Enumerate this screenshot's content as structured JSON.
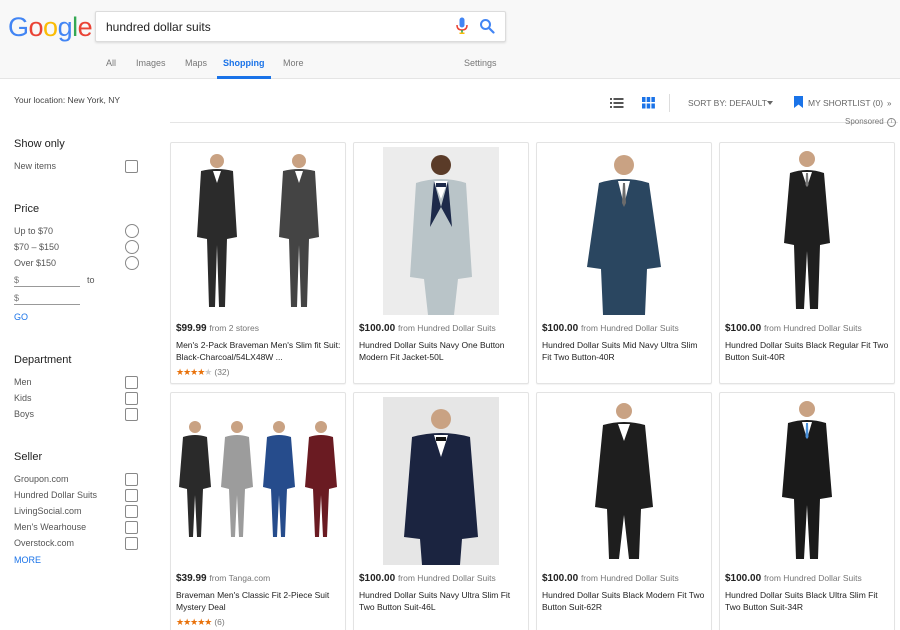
{
  "logo": {
    "letters": [
      "G",
      "o",
      "o",
      "g",
      "l",
      "e"
    ],
    "colors": [
      "#4285f4",
      "#ea4335",
      "#fbbc05",
      "#4285f4",
      "#34a853",
      "#ea4335"
    ]
  },
  "search": {
    "query": "hundred dollar suits"
  },
  "tabs": [
    {
      "label": "All"
    },
    {
      "label": "Images"
    },
    {
      "label": "Maps"
    },
    {
      "label": "Shopping"
    },
    {
      "label": "More"
    },
    {
      "label": "Settings"
    }
  ],
  "sidebar": {
    "location": "Your location: New York, NY",
    "show_only": {
      "heading": "Show only",
      "items": [
        "New items"
      ]
    },
    "price": {
      "heading": "Price",
      "options": [
        "Up to $70",
        "$70 – $150",
        "Over $150"
      ],
      "from_placeholder": "$",
      "to_label": "to",
      "to_placeholder": "$",
      "go": "GO"
    },
    "department": {
      "heading": "Department",
      "items": [
        "Men",
        "Kids",
        "Boys"
      ]
    },
    "seller": {
      "heading": "Seller",
      "items": [
        "Groupon.com",
        "Hundred Dollar Suits",
        "LivingSocial.com",
        "Men's Wearhouse",
        "Overstock.com"
      ],
      "more": "MORE"
    }
  },
  "toolbar": {
    "sort": "SORT BY: DEFAULT",
    "shortlist": "MY SHORTLIST (0)",
    "sponsored": "Sponsored",
    "accent": "#1a73e8"
  },
  "products": [
    {
      "price": "$99.99",
      "from": "from 2 stores",
      "title": "Men's 2-Pack Braveman Men's Slim fit Suit: Black-Charcoal/54LX48W ...",
      "rating_stars": 3.5,
      "rating_count": "(32)"
    },
    {
      "price": "$100.00",
      "from": "from Hundred Dollar Suits",
      "title": "Hundred Dollar Suits Navy One Button Modern Fit Jacket-50L"
    },
    {
      "price": "$100.00",
      "from": "from Hundred Dollar Suits",
      "title": "Hundred Dollar Suits Mid Navy Ultra Slim Fit Two Button-40R"
    },
    {
      "price": "$100.00",
      "from": "from Hundred Dollar Suits",
      "title": "Hundred Dollar Suits Black Regular Fit Two Button Suit-40R"
    },
    {
      "price": "$39.99",
      "from": "from Tanga.com",
      "title": "Braveman Men's Classic Fit 2-Piece Suit Mystery Deal",
      "rating_stars": 5,
      "rating_count": "(6)"
    },
    {
      "price": "$100.00",
      "from": "from Hundred Dollar Suits",
      "title": "Hundred Dollar Suits Navy Ultra Slim Fit Two Button Suit-46L"
    },
    {
      "price": "$100.00",
      "from": "from Hundred Dollar Suits",
      "title": "Hundred Dollar Suits Black Modern Fit Two Button Suit-62R"
    },
    {
      "price": "$100.00",
      "from": "from Hundred Dollar Suits",
      "title": "Hundred Dollar Suits Black Ultra Slim Fit Two Button Suit-34R"
    }
  ]
}
